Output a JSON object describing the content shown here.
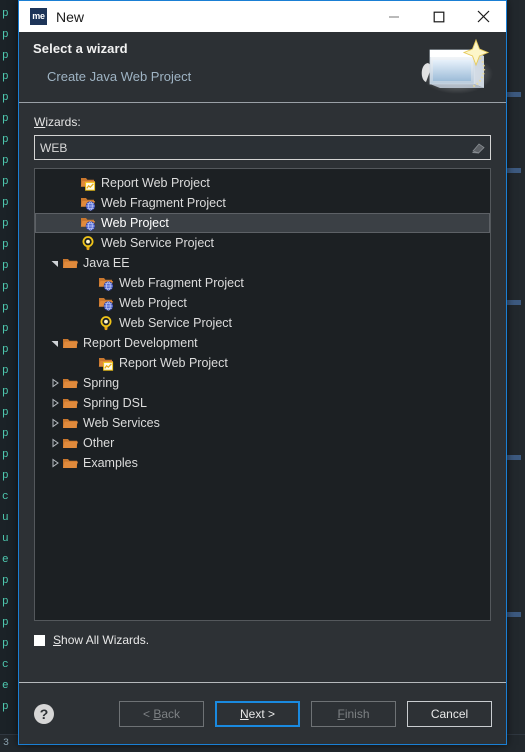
{
  "window": {
    "title": "New",
    "app_icon_text": "me",
    "controls": [
      {
        "name": "minimize",
        "glyph": "minimize-icon"
      },
      {
        "name": "maximize",
        "glyph": "maximize-icon"
      },
      {
        "name": "close",
        "glyph": "close-icon"
      }
    ]
  },
  "header": {
    "title": "Select a wizard",
    "subtitle": "Create Java Web Project",
    "banner_icon": "new-window-sparkle-icon"
  },
  "search": {
    "label": "Wizards:",
    "label_mnemonic": "W",
    "value": "WEB",
    "placeholder": "",
    "clear_icon": "eraser-icon"
  },
  "tree": {
    "items": [
      {
        "label": "Report Web Project",
        "indent": 1,
        "icon": "folder-report-icon",
        "twisty": "none",
        "selected": false
      },
      {
        "label": "Web Fragment Project",
        "indent": 1,
        "icon": "folder-web-icon",
        "twisty": "none",
        "selected": false
      },
      {
        "label": "Web Project",
        "indent": 1,
        "icon": "folder-web-icon",
        "twisty": "none",
        "selected": true
      },
      {
        "label": "Web Service Project",
        "indent": 1,
        "icon": "service-ring-icon",
        "twisty": "none",
        "selected": false
      },
      {
        "label": "Java EE",
        "indent": 0,
        "icon": "folder-open-icon",
        "twisty": "expanded",
        "selected": false
      },
      {
        "label": "Web Fragment Project",
        "indent": 2,
        "icon": "folder-web-icon",
        "twisty": "none",
        "selected": false
      },
      {
        "label": "Web Project",
        "indent": 2,
        "icon": "folder-web-icon",
        "twisty": "none",
        "selected": false
      },
      {
        "label": "Web Service Project",
        "indent": 2,
        "icon": "service-ring-icon",
        "twisty": "none",
        "selected": false
      },
      {
        "label": "Report Development",
        "indent": 0,
        "icon": "folder-open-icon",
        "twisty": "expanded",
        "selected": false
      },
      {
        "label": "Report Web Project",
        "indent": 2,
        "icon": "folder-report-icon",
        "twisty": "none",
        "selected": false
      },
      {
        "label": "Spring",
        "indent": 0,
        "icon": "folder-open-icon",
        "twisty": "collapsed",
        "selected": false
      },
      {
        "label": "Spring DSL",
        "indent": 0,
        "icon": "folder-open-icon",
        "twisty": "collapsed",
        "selected": false
      },
      {
        "label": "Web Services",
        "indent": 0,
        "icon": "folder-open-icon",
        "twisty": "collapsed",
        "selected": false
      },
      {
        "label": "Other",
        "indent": 0,
        "icon": "folder-open-icon",
        "twisty": "collapsed",
        "selected": false
      },
      {
        "label": "Examples",
        "indent": 0,
        "icon": "folder-open-icon",
        "twisty": "collapsed",
        "selected": false
      }
    ]
  },
  "show_all": {
    "label": "Show All Wizards.",
    "label_mnemonic": "S",
    "checked": false
  },
  "buttons": {
    "help_icon": "help-question-icon",
    "items": [
      {
        "label": "< Back",
        "mnemonic": "B",
        "state": "disabled"
      },
      {
        "label": "Next >",
        "mnemonic": "N",
        "state": "focused"
      },
      {
        "label": "Finish",
        "mnemonic": "F",
        "state": "disabled"
      },
      {
        "label": "Cancel",
        "mnemonic": "",
        "state": "normal"
      }
    ]
  },
  "colors": {
    "accent_blue": "#1a7fd4",
    "dialog_bg": "#2d3135",
    "tree_bg": "#1c2023",
    "selection_bg": "#3b4045",
    "folder_orange": "#e08a3c",
    "service_gold": "#f0c419",
    "link_text": "#9fb4c4"
  },
  "background": {
    "editor_lines": [
      "p",
      "p",
      "p",
      "p",
      "p",
      "p",
      "p",
      "p",
      "p",
      "p",
      "p",
      "p",
      "p",
      "p",
      "p",
      "p",
      "p",
      "p",
      "p",
      "p",
      "p",
      "p",
      "p",
      "c",
      "u",
      "u",
      "e",
      "p",
      "p",
      "p",
      "p",
      "c",
      "e",
      "p"
    ],
    "status_text": "3"
  }
}
